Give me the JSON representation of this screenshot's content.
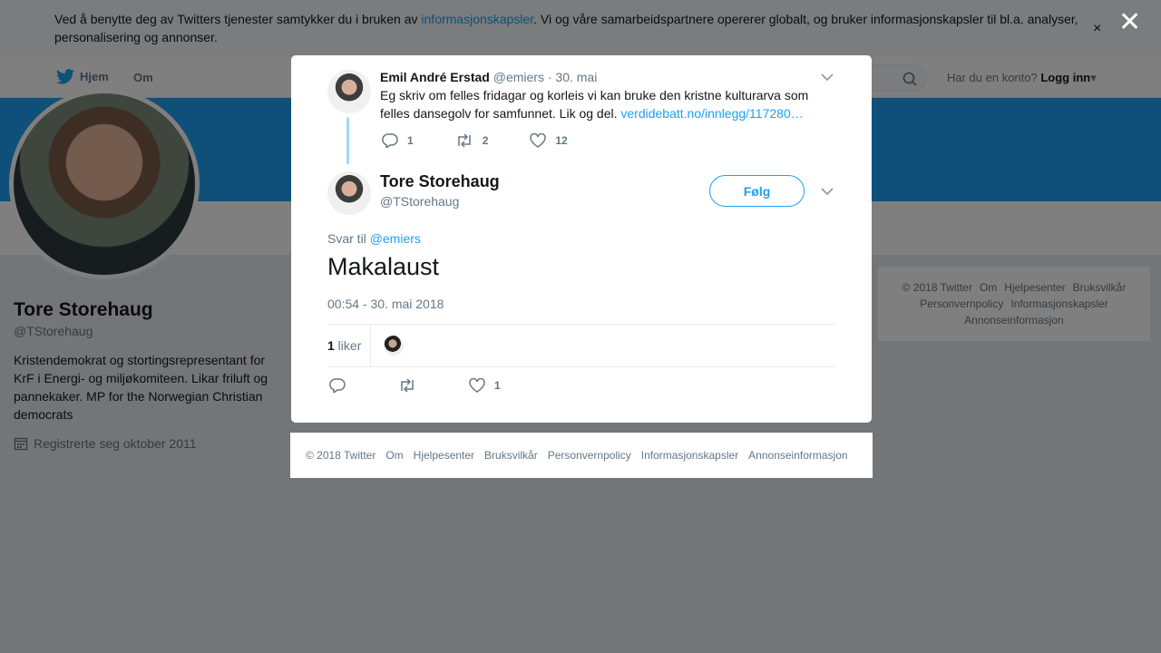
{
  "cookie": {
    "text_before": "Ved å benytte deg av Twitters tjenester samtykker du i bruken av ",
    "link": "informasjonskapsler",
    "text_after": ". Vi og våre samarbeidspartnere opererer globalt, og bruker informasjonskapsler til bl.a. analyser, personalisering og annonser.",
    "close": "×"
  },
  "nav": {
    "home": "Hjem",
    "about": "Om",
    "login_prompt": "Har du en konto?",
    "login": "Logg inn"
  },
  "profile": {
    "name": "Tore Storehaug",
    "handle": "@TStorehaug",
    "bio": "Kristendemokrat og stortingsrepresentant for KrF i Energi- og miljøkomiteen. Likar friluft og pannekaker. MP for the Norwegian Christian democrats",
    "joined": "Registrerte seg oktober 2011"
  },
  "sidebar_footer": [
    "© 2018 Twitter",
    "Om",
    "Hjelpesenter",
    "Bruksvilkår",
    "Personvernpolicy",
    "Informasjonskapsler",
    "Annonseinformasjon"
  ],
  "overlay": {
    "close": "✕"
  },
  "parent_tweet": {
    "name": "Emil André Erstad",
    "handle": "@emiers",
    "date": " · 30. mai",
    "text": "Eg skriv om felles fridagar og korleis vi kan bruke den kristne kulturarva som felles dansegolv for samfunnet. Lik og del. ",
    "link": "verdidebatt.no/innlegg/117280…",
    "replies": "1",
    "retweets": "2",
    "likes": "12"
  },
  "tweet": {
    "name": "Tore Storehaug",
    "handle": "@TStorehaug",
    "follow": "Følg",
    "reply_to_label": "Svar til ",
    "reply_to_mention": "@emiers",
    "text": "Makalaust",
    "time": "00:54 - 30. mai 2018",
    "likes_count": "1",
    "likes_label": " liker",
    "action_likes": "1"
  },
  "modal_footer": [
    "© 2018 Twitter",
    "Om",
    "Hjelpesenter",
    "Bruksvilkår",
    "Personvernpolicy",
    "Informasjonskapsler",
    "Annonseinformasjon"
  ],
  "colors": {
    "brand": "#1da1f2",
    "banner": "#1da1f2",
    "text": "#14171a",
    "muted": "#657786"
  }
}
